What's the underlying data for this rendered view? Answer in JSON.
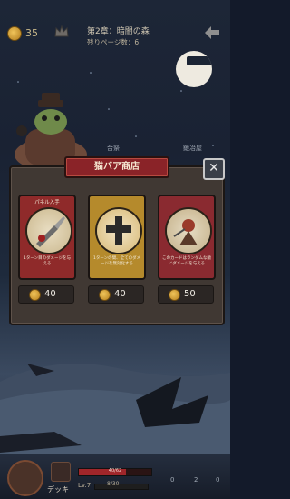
{
  "header": {
    "coins": "35",
    "stage_title": "第2章：暗闇の森",
    "stage_sub": "残りページ数：6"
  },
  "background_tabs": [
    "合祭",
    "鍛冶屋"
  ],
  "shop": {
    "title": "猫バア商店",
    "close_label": "✕",
    "cards": [
      {
        "label": "パネル入手",
        "desc": "1ターン目のダメージを与える",
        "price": "40",
        "color": "#8f2a2a"
      },
      {
        "label": "",
        "desc": "1ターンの間、全てのダメージを無効化する",
        "price": "40",
        "color": "#b58a2c"
      },
      {
        "label": "",
        "desc": "このカードはランダムな敵にダメージを与える",
        "price": "50",
        "color": "#8a2a30"
      }
    ]
  },
  "bottom": {
    "deck_label": "デッキ",
    "level": "Lv.7",
    "hp_text": "40/62",
    "hp_ratio": 0.65,
    "xp_text": "8/30",
    "stats": [
      "0",
      "2",
      "0"
    ]
  },
  "colors": {
    "panel": "#403833",
    "ribbon": "#8a2328",
    "accent_gold": "#f0c45a"
  }
}
